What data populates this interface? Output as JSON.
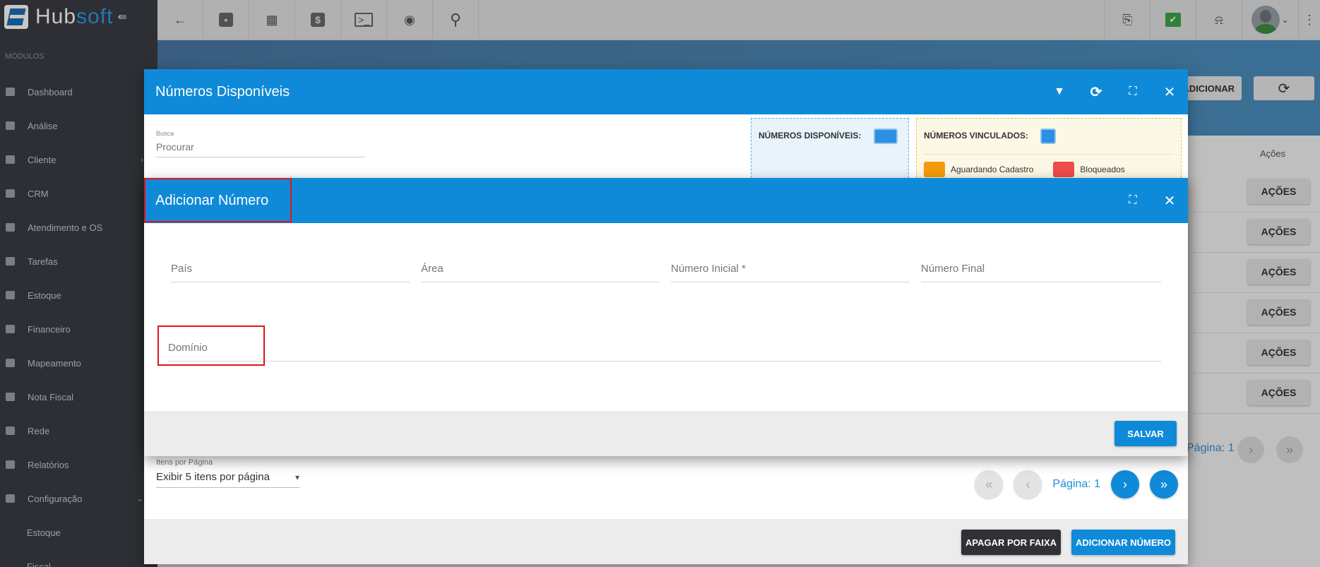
{
  "app": {
    "logo_part1": "Hub",
    "logo_part2": "soft",
    "collapse_icon": "menu-collapse-icon"
  },
  "sidebar": {
    "section_label": "MÓDULOS",
    "items": [
      {
        "label": "Dashboard",
        "icon": "dashboard-icon"
      },
      {
        "label": "Análise",
        "icon": "pie-chart-icon"
      },
      {
        "label": "Cliente",
        "icon": "contact-card-icon",
        "chevron": "›"
      },
      {
        "label": "CRM",
        "icon": "crm-icon"
      },
      {
        "label": "Atendimento e OS",
        "icon": "calendar-clock-icon"
      },
      {
        "label": "Tarefas",
        "icon": "tasks-icon"
      },
      {
        "label": "Estoque",
        "icon": "box-icon"
      },
      {
        "label": "Financeiro",
        "icon": "money-icon"
      },
      {
        "label": "Mapeamento",
        "icon": "map-pin-icon"
      },
      {
        "label": "Nota Fiscal",
        "icon": "invoice-icon"
      },
      {
        "label": "Rede",
        "icon": "network-icon"
      },
      {
        "label": "Relatórios",
        "icon": "report-icon"
      },
      {
        "label": "Configuração",
        "icon": "gear-icon",
        "chevron": "⌄"
      }
    ],
    "sub_items": [
      {
        "label": "Estoque"
      },
      {
        "label": "Fiscal"
      }
    ]
  },
  "topbar": {
    "back_glyph": "←",
    "dollar_glyph": "$",
    "terminal_glyph": ">_",
    "eye_glyph": "◉",
    "search_glyph": "⚲",
    "pdf_glyph": "⎘",
    "check_glyph": "✔",
    "bell_glyph": "🔔",
    "caret_glyph": "⌄",
    "more_glyph": "⋮"
  },
  "background_page": {
    "adicionar_label": "ADICIONAR",
    "refresh_glyph": "⟳",
    "acoes_header": "Ações",
    "acoes_buttons": [
      "AÇÕES",
      "AÇÕES",
      "AÇÕES",
      "AÇÕES",
      "AÇÕES",
      "AÇÕES"
    ],
    "pagina_label": "Página: 1",
    "next_glyph": "›",
    "last_glyph": "»"
  },
  "numeros_modal": {
    "title": "Números Disponíveis",
    "filter_glyph": "▼",
    "refresh_glyph": "⟳",
    "expand_glyph": "⛶",
    "close_glyph": "✕",
    "search": {
      "label": "Busca",
      "placeholder": "Procurar"
    },
    "legend_disponiveis": "NÚMEROS DISPONÍVEIS:",
    "legend_vinculados": "NÚMEROS VINCULADOS:",
    "legend_aguardando": "Aguardando Cadastro",
    "legend_bloqueados": "Bloqueados",
    "colors": {
      "disponivel": "#2e8fe0",
      "aguardando": "#f59a0c",
      "bloqueado": "#ef4b4b"
    },
    "items_per_page": {
      "label": "Itens por Página",
      "selected": "Exibir 5 itens por página",
      "caret": "▾"
    },
    "pager": {
      "first_glyph": "«",
      "prev_glyph": "‹",
      "page_label": "Página: 1",
      "next_glyph": "›",
      "last_glyph": "»"
    },
    "apagar_label": "APAGAR POR FAIXA",
    "adicionar_label": "ADICIONAR NÚMERO"
  },
  "adicionar_modal": {
    "title": "Adicionar Número",
    "expand_glyph": "⛶",
    "close_glyph": "✕",
    "fields": {
      "pais": "País",
      "area": "Área",
      "numero_inicial": "Número Inicial *",
      "numero_final": "Número Final",
      "dominio": "Domínio"
    },
    "salvar_label": "SALVAR"
  },
  "accent_color": "#0f8ad8",
  "highlight_color": "#e0141b"
}
